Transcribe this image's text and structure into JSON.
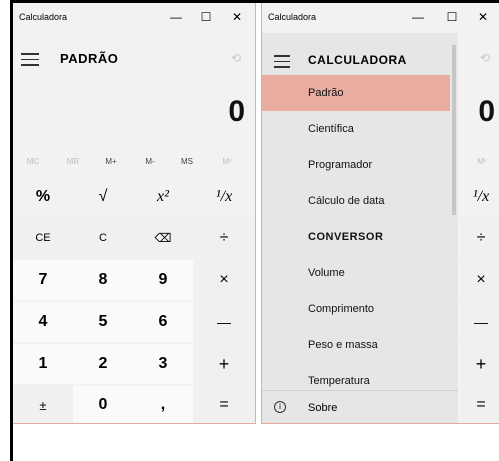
{
  "left_window": {
    "title": "Calculadora",
    "controls": {
      "minimize": "—",
      "maximize": "☐",
      "close": "✕"
    },
    "mode_title": "PADRÃO",
    "display_value": "0",
    "memory_buttons": [
      "MC",
      "MR",
      "M+",
      "M-",
      "MS",
      "Mᵛ"
    ],
    "function_buttons": [
      "%",
      "√",
      "x²",
      "¹/x"
    ],
    "keypad": [
      [
        "CE",
        "C",
        "⌫",
        "÷"
      ],
      [
        "7",
        "8",
        "9",
        "×"
      ],
      [
        "4",
        "5",
        "6",
        "—"
      ],
      [
        "1",
        "2",
        "3",
        "+"
      ],
      [
        "±",
        "0",
        ",",
        "="
      ]
    ]
  },
  "right_window": {
    "title": "Calculadora",
    "controls": {
      "minimize": "—",
      "maximize": "☐",
      "close": "✕"
    },
    "display_value": "0",
    "menu": {
      "title": "CALCULADORA",
      "items": [
        {
          "label": "Padrão",
          "selected": true
        },
        {
          "label": "Científica"
        },
        {
          "label": "Programador"
        },
        {
          "label": "Cálculo de data"
        }
      ],
      "converter_title": "CONVERSOR",
      "converter_items": [
        "Volume",
        "Comprimento",
        "Peso e massa",
        "Temperatura"
      ],
      "footer_label": "Sobre"
    },
    "visible_buttons": {
      "mem": "Mᵛ",
      "fn": "¹/x",
      "ops": [
        "÷",
        "×",
        "—",
        "+",
        "="
      ]
    }
  },
  "colors": {
    "accent": "#e9aca1",
    "window_bg": "#f2f2f2",
    "menu_bg": "#e6e6e6"
  }
}
